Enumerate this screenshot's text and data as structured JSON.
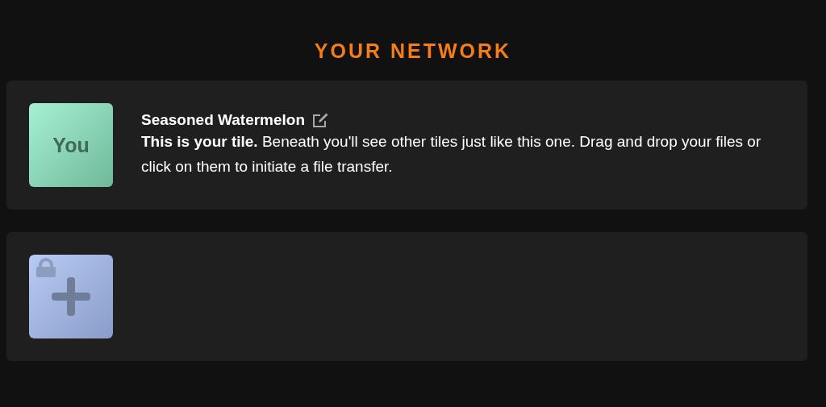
{
  "heading": "YOUR NETWORK",
  "cards": [
    {
      "kind": "you",
      "tile_label": "You",
      "name": "Seasoned Watermelon",
      "description": "**This is your tile.** Beneath you'll see other tiles just like this one. Drag and drop your files or click on them to initiate a file transfer."
    },
    {
      "kind": "add"
    }
  ]
}
